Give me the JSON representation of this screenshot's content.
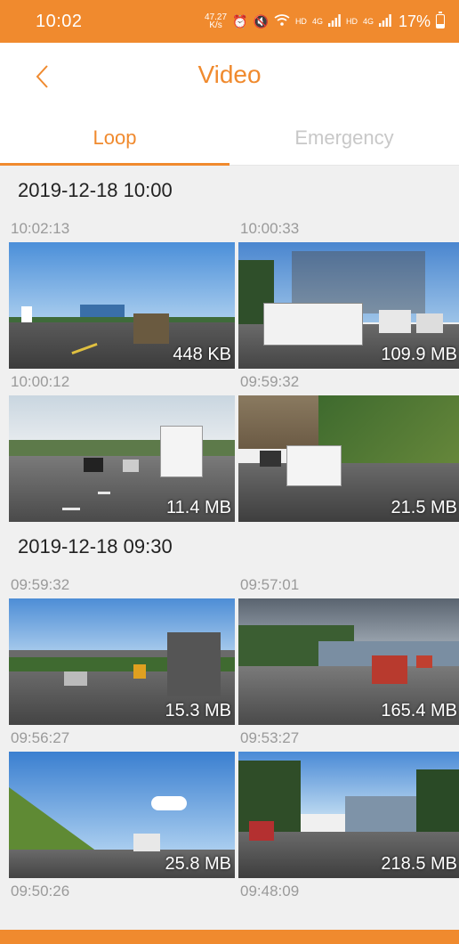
{
  "status_bar": {
    "time": "10:02",
    "speed_value": "47.27",
    "speed_unit": "K/s",
    "hd1": "HD",
    "net1": "4G",
    "hd2": "HD",
    "net2": "4G",
    "battery": "17%"
  },
  "header": {
    "title": "Video"
  },
  "tabs": [
    {
      "label": "Loop",
      "active": true
    },
    {
      "label": "Emergency",
      "active": false
    }
  ],
  "groups": [
    {
      "date": "2019-12-18 10:00",
      "items": [
        {
          "time": "10:02:13",
          "size": "448 KB"
        },
        {
          "time": "10:00:33",
          "size": "109.9 MB"
        },
        {
          "time": "10:00:12",
          "size": "11.4 MB"
        },
        {
          "time": "09:59:32",
          "size": "21.5 MB"
        }
      ]
    },
    {
      "date": "2019-12-18 09:30",
      "items": [
        {
          "time": "09:59:32",
          "size": "15.3 MB"
        },
        {
          "time": "09:57:01",
          "size": "165.4 MB"
        },
        {
          "time": "09:56:27",
          "size": "25.8 MB"
        },
        {
          "time": "09:53:27",
          "size": "218.5 MB"
        },
        {
          "time": "09:50:26",
          "size": ""
        },
        {
          "time": "09:48:09",
          "size": ""
        }
      ]
    }
  ],
  "colors": {
    "accent": "#f08a2e",
    "background": "#f0f0f0",
    "muted_text": "#9a9a9a"
  }
}
